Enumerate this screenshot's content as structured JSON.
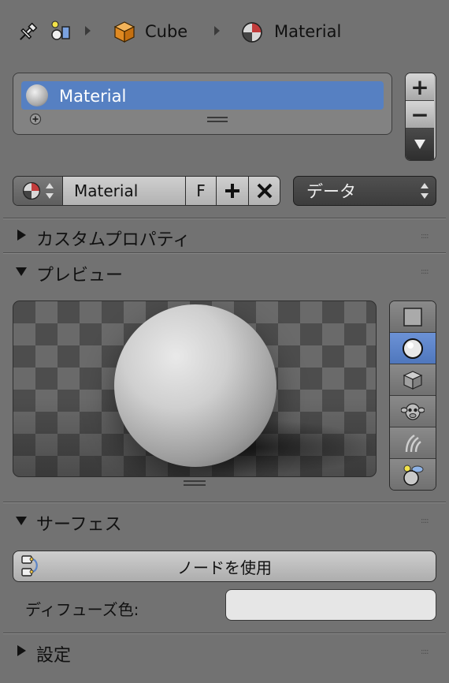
{
  "breadcrumb": {
    "object_label": "Cube",
    "material_label": "Material"
  },
  "slots": {
    "items": [
      {
        "label": "Material",
        "selected": true
      }
    ]
  },
  "material_selector": {
    "name": "Material",
    "fake_user_label": "F",
    "link_value": "データ"
  },
  "panels": {
    "custom_props": {
      "title": "カスタムプロパティ",
      "expanded": false
    },
    "preview": {
      "title": "プレビュー",
      "expanded": true
    },
    "surface": {
      "title": "サーフェス",
      "expanded": true
    },
    "settings": {
      "title": "設定",
      "expanded": false
    }
  },
  "preview": {
    "selected_shape": "sphere",
    "shapes": [
      "flat-plane-icon",
      "sphere-icon",
      "cube-icon",
      "monkey-icon",
      "hair-icon",
      "sphere-sky-icon"
    ]
  },
  "surface": {
    "use_nodes_label": "ノードを使用",
    "diffuse_label": "ディフューズ色:",
    "diffuse_color": "#e6e6e6"
  },
  "colors": {
    "background": "#727272",
    "selection": "#5680c2"
  }
}
